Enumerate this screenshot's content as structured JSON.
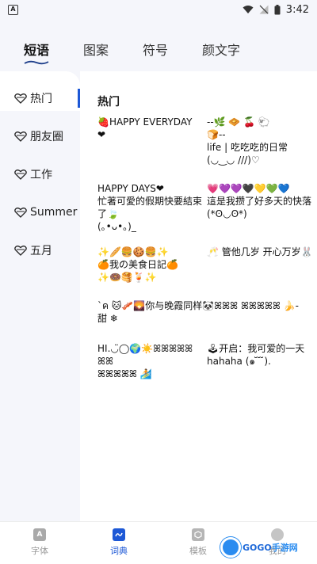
{
  "status_bar": {
    "app_badge": "A",
    "time": "3:42"
  },
  "top_tabs": [
    {
      "label": "短语",
      "active": true
    },
    {
      "label": "图案",
      "active": false
    },
    {
      "label": "符号",
      "active": false
    },
    {
      "label": "颜文字",
      "active": false
    }
  ],
  "sidebar": {
    "items": [
      {
        "label": "热门",
        "active": true
      },
      {
        "label": "朋友圈",
        "active": false
      },
      {
        "label": "工作",
        "active": false
      },
      {
        "label": "Summer",
        "active": false
      },
      {
        "label": "五月",
        "active": false
      }
    ]
  },
  "content": {
    "section_title": "热门",
    "phrases": [
      "🍓HAPPY EVERYDAY ❤",
      "--🌿 🧇 🍒 🐑\n🍞--\nlife | 吃吃吃的日常\n(◡‿◡ ///)♡",
      "HAPPY DAYS❤\n忙著可愛的假期快要結束了🍃\n(｡•ᴗ•｡)_",
      "💗💜💜🖤💛💚💙\n這是我攒了好多天的快落\n(*ʘ◡ʘ*)",
      "✨🥖🍔🍪🍔✨\n🍊我の美食日記🍊\n✨🍩🥞🍹✨",
      "🥂 管他几岁 开心万岁🐰",
      "ˋค 🐱🥓🌄你与晚霞同样🐼ꕤꕤꕤ ꕤꕤꕤꕤꕤ 🍌-\n甜 ❄",
      "HI.◡̈◯🌍☀️ꕤꕤꕤꕤꕤ ꕤꕤ\nꕤꕤꕤꕤꕤ 🏄",
      "🕹开启：我可爱的一天\nhahaha (๑ ̆ ̆ ̆)."
    ]
  },
  "bottom_nav": [
    {
      "label": "字体",
      "icon": "font-icon",
      "active": false
    },
    {
      "label": "词典",
      "icon": "dictionary-icon",
      "active": true
    },
    {
      "label": "模板",
      "icon": "template-icon",
      "active": false
    },
    {
      "label": "我的",
      "icon": "profile-icon",
      "active": false
    }
  ],
  "watermark": {
    "text_latin": "GOGO",
    "text_cn": "手游网"
  },
  "colors": {
    "accent": "#1d58d6",
    "sidebar_bg": "#f5f6fb",
    "content_bg": "#ffffff"
  }
}
